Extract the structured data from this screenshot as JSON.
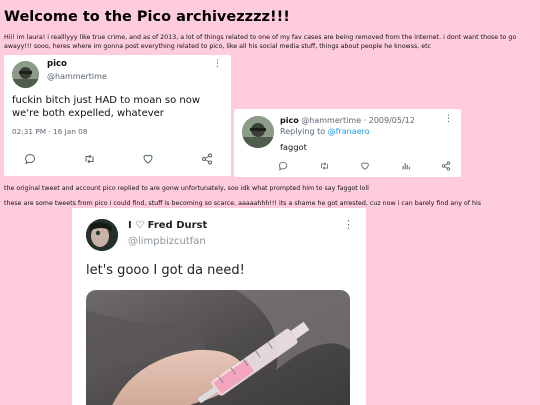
{
  "page": {
    "title": "Welcome to the Pico archivezzzz!!!",
    "intro": "Hii! im laura! i realllyyy like true crime, and as of 2013, a lot of things related to one of my fav cases are being removed from the internet. i dont want those to go awayy!!! sooo, heres where im gonna post everything related to pico, like all his social media stuff, things about people he knowss, etc",
    "caption_1": "the original tweet and account pico replied to are gonw unfortunately, soo idk what prompted him to say faggot loll",
    "caption_2": "these are some tweets from pico i could find, stuff is becoming so scarce, aaaaahhh!!! its a shame he got arrested, cuz now i can barely find any of his"
  },
  "tweet_1": {
    "name": "pico",
    "handle": "@hammertime",
    "text": "fuckin bitch just HAD to moan so now we're both expelled, whatever",
    "timestamp": "02:31 PM · 16 Jan 08",
    "more_icon": "⋮"
  },
  "tweet_2": {
    "name": "pico",
    "handle_date": "@hammertime · 2009/05/12",
    "replying_prefix": "Replying to ",
    "replying_to": "@franaero",
    "text": "faggot",
    "more_icon": "⋮"
  },
  "tweet_3": {
    "name": "I ♡ Fred Durst",
    "handle": "@limpbizcutfan",
    "text": "let's gooo I got da need!",
    "more_icon": "⋮"
  },
  "colors": {
    "background": "#ffccdf",
    "link_blue": "#1d9bf0",
    "muted_text": "#5b6670"
  }
}
